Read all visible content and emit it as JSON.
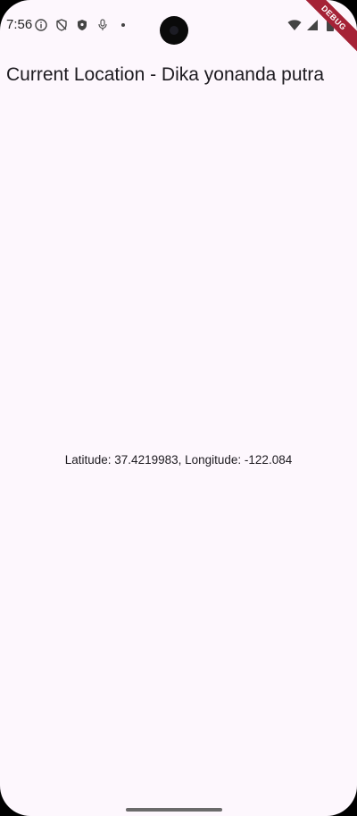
{
  "status_bar": {
    "time": "7:56",
    "left_icons": [
      "info-icon",
      "shield-off-icon",
      "shield-icon",
      "mic-icon",
      "notification-dot-icon"
    ],
    "right_icons": [
      "wifi-icon",
      "signal-icon",
      "battery-icon"
    ]
  },
  "debug_banner": {
    "label": "DEBUG",
    "color": "#a52236"
  },
  "app_bar": {
    "title": "Current Location - Dika yonanda putra"
  },
  "body": {
    "location_text": "Latitude: 37.4219983, Longitude: -122.084"
  },
  "colors": {
    "background": "#fdf7fd",
    "text": "#1d1b20"
  }
}
